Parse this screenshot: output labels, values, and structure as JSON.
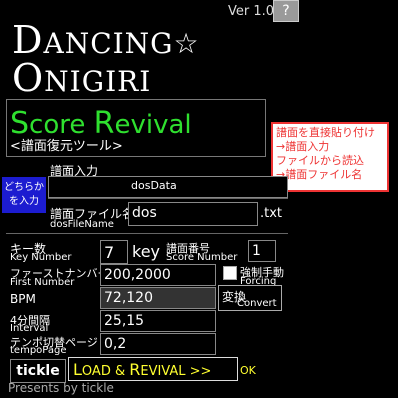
{
  "header": {
    "version": "Ver 1.0.1",
    "help_label": "?",
    "logo_line1_big": "D",
    "logo_line1_rest": "ANCING",
    "logo_star": "☆",
    "logo_line2_big": "O",
    "logo_line2_rest": "NIGIRI"
  },
  "title": {
    "score_revival_1": "S",
    "score_revival_2": "core ",
    "score_revival_3": "R",
    "score_revival_4": "evival",
    "subtitle": "<譜面復元ツール>"
  },
  "note": {
    "line1": "譜面を直接貼り付け",
    "line2": "→譜面入力",
    "line3": "ファイルから読込",
    "line4": "→譜面ファイル名"
  },
  "input_choice": {
    "label_line1": "どちらか",
    "label_line2": "を入力"
  },
  "score_input": {
    "label": "譜面入力",
    "value": "dosData"
  },
  "score_file": {
    "label": "譜面ファイル名",
    "sublabel": "dosFileName",
    "value": "dos",
    "extension": ".txt"
  },
  "key_number": {
    "label": "キー数",
    "sublabel": "Key Number",
    "value": "7",
    "unit": "key"
  },
  "score_number": {
    "label": "譜面番号",
    "sublabel": "Score Number",
    "value": "1"
  },
  "first_number": {
    "label": "ファーストナンバー",
    "sublabel": "First Number",
    "value": "200,2000"
  },
  "forcing": {
    "label": "強制手動",
    "sublabel": "Forcing"
  },
  "bpm": {
    "label": "BPM",
    "value": "72,120"
  },
  "convert": {
    "label": "変換",
    "sublabel": "Convert"
  },
  "interval": {
    "label": "4分間隔",
    "sublabel": "Interval",
    "value": "25,15"
  },
  "tempo_page": {
    "label": "テンポ切替ページ",
    "sublabel": "tempoPage",
    "value": "0,2"
  },
  "footer": {
    "tickle_label": "tickle",
    "load_1": "L",
    "load_2": "OAD & ",
    "load_3": "R",
    "load_4": "EVIVAL >>",
    "ok_label": "OK",
    "presents": "Presents by tickle"
  }
}
